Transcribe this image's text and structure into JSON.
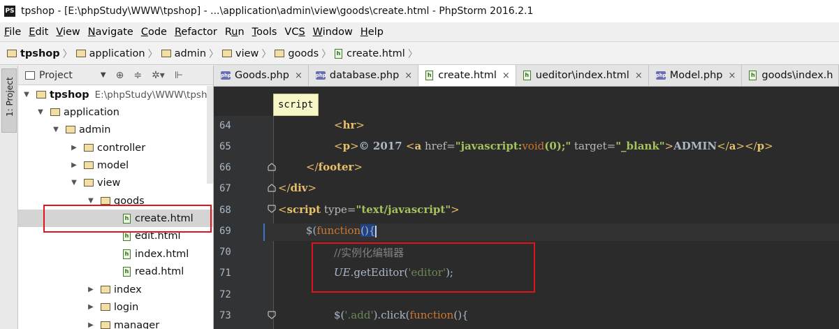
{
  "window": {
    "app_icon": "PS",
    "title": "tpshop - [E:\\phpStudy\\WWW\\tpshop] - ...\\application\\admin\\view\\goods\\create.html - PhpStorm 2016.2.1"
  },
  "menu": {
    "items": [
      {
        "u": "F",
        "rest": "ile"
      },
      {
        "u": "E",
        "rest": "dit"
      },
      {
        "u": "V",
        "rest": "iew"
      },
      {
        "u": "N",
        "rest": "avigate"
      },
      {
        "u": "C",
        "rest": "ode"
      },
      {
        "u": "R",
        "rest": "efactor"
      },
      {
        "u": "",
        "pre": "R",
        "mid": "u",
        "rest": "n"
      },
      {
        "u": "T",
        "rest": "ools"
      },
      {
        "u": "",
        "pre": "VC",
        "mid": "S",
        "rest": ""
      },
      {
        "u": "W",
        "rest": "indow"
      },
      {
        "u": "H",
        "rest": "elp"
      }
    ]
  },
  "breadcrumb": {
    "items": [
      "tpshop",
      "application",
      "admin",
      "view",
      "goods",
      "create.html"
    ]
  },
  "toolstrip": {
    "label": "1: Project"
  },
  "project_panel": {
    "title": "Project",
    "dropdown_icon": "chevron-down-icon",
    "tools": [
      "⊕",
      "≑",
      "✲▾",
      "⊩"
    ],
    "tree": [
      {
        "label": "tpshop",
        "path": "E:\\phpStudy\\WWW\\tpsh",
        "type": "folder",
        "arrow": "▼"
      },
      {
        "label": "application",
        "type": "folder",
        "arrow": "▼"
      },
      {
        "label": "admin",
        "type": "folder",
        "arrow": "▼"
      },
      {
        "label": "controller",
        "type": "folder",
        "arrow": "▶"
      },
      {
        "label": "model",
        "type": "folder",
        "arrow": "▶"
      },
      {
        "label": "view",
        "type": "folder",
        "arrow": "▼"
      },
      {
        "label": "goods",
        "type": "folder",
        "arrow": "▼"
      },
      {
        "label": "create.html",
        "type": "file",
        "arrow": ""
      },
      {
        "label": "edit.html",
        "type": "file",
        "arrow": ""
      },
      {
        "label": "index.html",
        "type": "file",
        "arrow": ""
      },
      {
        "label": "read.html",
        "type": "file",
        "arrow": ""
      },
      {
        "label": "index",
        "type": "folder",
        "arrow": "▶"
      },
      {
        "label": "login",
        "type": "folder",
        "arrow": "▶"
      },
      {
        "label": "manager",
        "type": "folder",
        "arrow": "▶"
      }
    ]
  },
  "tabs": [
    {
      "label": "Goods.php",
      "icon": "php",
      "active": false
    },
    {
      "label": "database.php",
      "icon": "php",
      "active": false
    },
    {
      "label": "create.html",
      "icon": "html",
      "active": true
    },
    {
      "label": "ueditor\\index.html",
      "icon": "html",
      "active": false
    },
    {
      "label": "Model.php",
      "icon": "php",
      "active": false
    },
    {
      "label": "goods\\index.h",
      "icon": "html",
      "active": false
    }
  ],
  "tab_close": "×",
  "php_icon_text": "php",
  "html_icon_text": "h",
  "tooltip": "script",
  "line_numbers": [
    "64",
    "65",
    "66",
    "67",
    "68",
    "69",
    "70",
    "71",
    "72",
    "73"
  ],
  "code": {
    "l64": [
      "<",
      "hr",
      ">"
    ],
    "l65": [
      "<",
      "p",
      ">",
      "© 2017 ",
      "<",
      "a",
      " href=",
      "\"javascript:",
      "void",
      "(0);\"",
      " target=",
      "\"_blank\"",
      ">",
      "ADMIN",
      "</",
      "a",
      ">",
      "</",
      "p",
      ">"
    ],
    "l66": [
      "</",
      "footer",
      ">"
    ],
    "l67": [
      "</",
      "div",
      ">"
    ],
    "l68": [
      "<",
      "script",
      " type=",
      "\"text/javascript\"",
      ">"
    ],
    "l69": [
      "$(",
      "function",
      "(){"
    ],
    "l70": "//实例化编辑器",
    "l71": [
      "UE",
      ".getEditor(",
      "'editor'",
      ");"
    ],
    "l73": [
      "$(",
      "'.add'",
      ").click(",
      "function",
      "(){"
    ]
  }
}
